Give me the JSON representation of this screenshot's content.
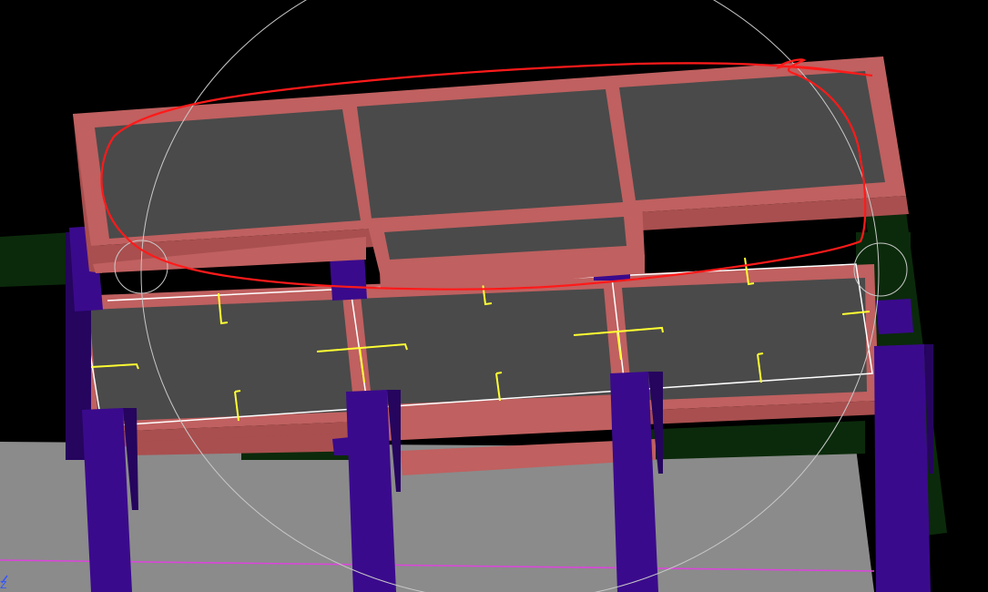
{
  "viewport": {
    "axis_label": "Z",
    "background": "#000000"
  },
  "colors": {
    "slab_top": "#4a4a4a",
    "slab_frame": "#c06060",
    "slab_frame_side": "#a94f4f",
    "column": "#3a0a8c",
    "column_dark": "#25055e",
    "floor": "#8b8b8b",
    "green_beam": "#0b2a0b",
    "annotation_red": "#ff1a1a",
    "orbit_circle": "#c8c8c8",
    "selection_white": "#ffffff",
    "marker_yellow": "#ffff33",
    "axis_magenta": "#dd44dd",
    "axis_blue": "#3355ff"
  }
}
